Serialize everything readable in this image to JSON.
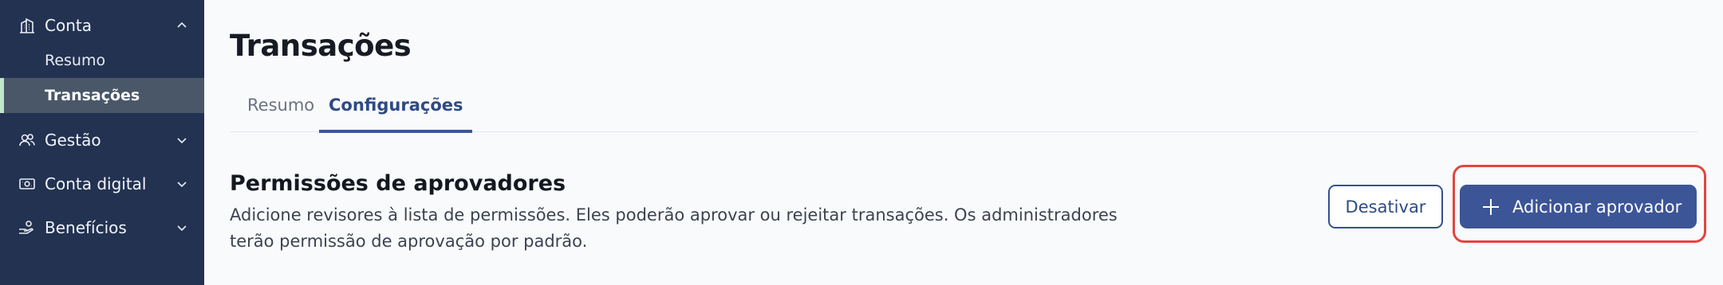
{
  "sidebar": {
    "sections": [
      {
        "label": "Conta",
        "icon": "building-icon",
        "expanded": true,
        "children": [
          {
            "label": "Resumo"
          },
          {
            "label": "Transações",
            "active": true
          }
        ]
      },
      {
        "label": "Gestão",
        "icon": "users-icon",
        "expanded": false
      },
      {
        "label": "Conta digital",
        "icon": "money-icon",
        "expanded": false
      },
      {
        "label": "Benefícios",
        "icon": "hand-coins-icon",
        "expanded": false
      }
    ]
  },
  "main": {
    "title": "Transações",
    "tabs": [
      {
        "label": "Resumo"
      },
      {
        "label": "Configurações",
        "active": true
      }
    ],
    "section": {
      "title": "Permissões de aprovadores",
      "description": "Adicione revisores à lista de permissões. Eles poderão aprovar ou rejeitar transações. Os administradores terão permissão de aprovação por padrão.",
      "disable_button": "Desativar",
      "add_button": "Adicionar aprovador"
    }
  },
  "colors": {
    "sidebar_bg": "#233251",
    "accent": "#3c5596",
    "active_marker": "#bfe7c8",
    "highlight": "#e2463f"
  }
}
